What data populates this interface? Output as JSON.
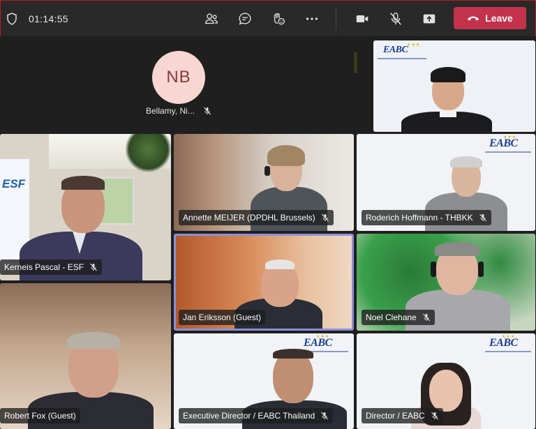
{
  "toolbar": {
    "timer": "01:14:55",
    "leave_label": "Leave",
    "icons": [
      "shield-icon",
      "participants-icon",
      "chat-icon",
      "reactions-icon",
      "more-icon",
      "camera-icon",
      "mic-off-icon",
      "share-icon",
      "phone-icon"
    ]
  },
  "avatar": {
    "initials": "NB",
    "name": "Bellamy, Ni..."
  },
  "tiles": [
    {
      "name": "Annette MEIJER (DPDHL Brussels)"
    },
    {
      "name": "Roderich Hoffmann - THBKK"
    },
    {
      "name": "Kerneis Pascal - ESF"
    },
    {
      "name": "Jan Eriksson (Guest)"
    },
    {
      "name": "Noel Clehane"
    },
    {
      "name": "Robert Fox (Guest)"
    },
    {
      "name": "Executive Director / EABC Thailand"
    },
    {
      "name": "Director / EABC"
    }
  ],
  "logos": {
    "eabc": "EABC",
    "esf": "ESF"
  },
  "colors": {
    "leave": "#c4314b",
    "avatar_bg": "#f8d7d3",
    "avatar_text": "#8a3a36",
    "active_border": "#8a8fd8"
  }
}
